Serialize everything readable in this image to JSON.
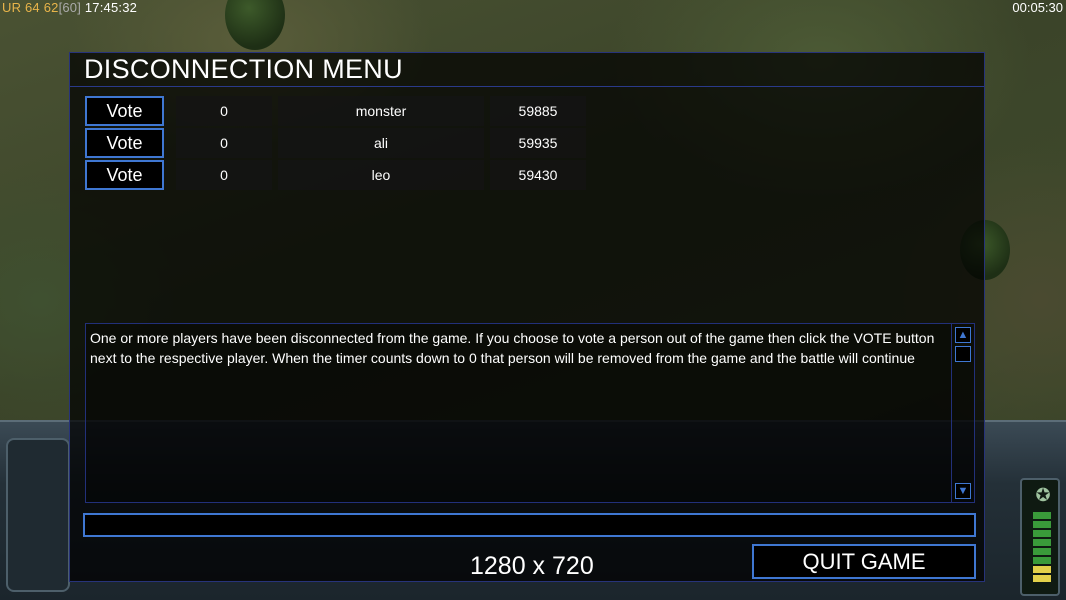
{
  "overlay": {
    "ur_label": "UR",
    "fps_a": "64",
    "fps_b": "62",
    "fps_cap": "[60]",
    "clock": "17:45:32",
    "game_timer": "00:05:30"
  },
  "menu": {
    "title": "DISCONNECTION MENU",
    "players": [
      {
        "vote_label": "Vote",
        "count": "0",
        "name": "monster",
        "ping": "59885"
      },
      {
        "vote_label": "Vote",
        "count": "0",
        "name": "ali",
        "ping": "59935"
      },
      {
        "vote_label": "Vote",
        "count": "0",
        "name": "leo",
        "ping": "59430"
      }
    ],
    "message": "One or more players have been disconnected from the game. If you choose to vote a person out of the game then click the VOTE button next to the respective player. When the timer counts down to 0 that person will be removed from the game and the battle will continue",
    "chat_value": "",
    "quit_label": "QUIT GAME"
  },
  "resolution_label": "1280 x 720",
  "colors": {
    "accent": "#3f77d2",
    "panel_border": "#27337a",
    "overlay_orange": "#e8b44a"
  }
}
